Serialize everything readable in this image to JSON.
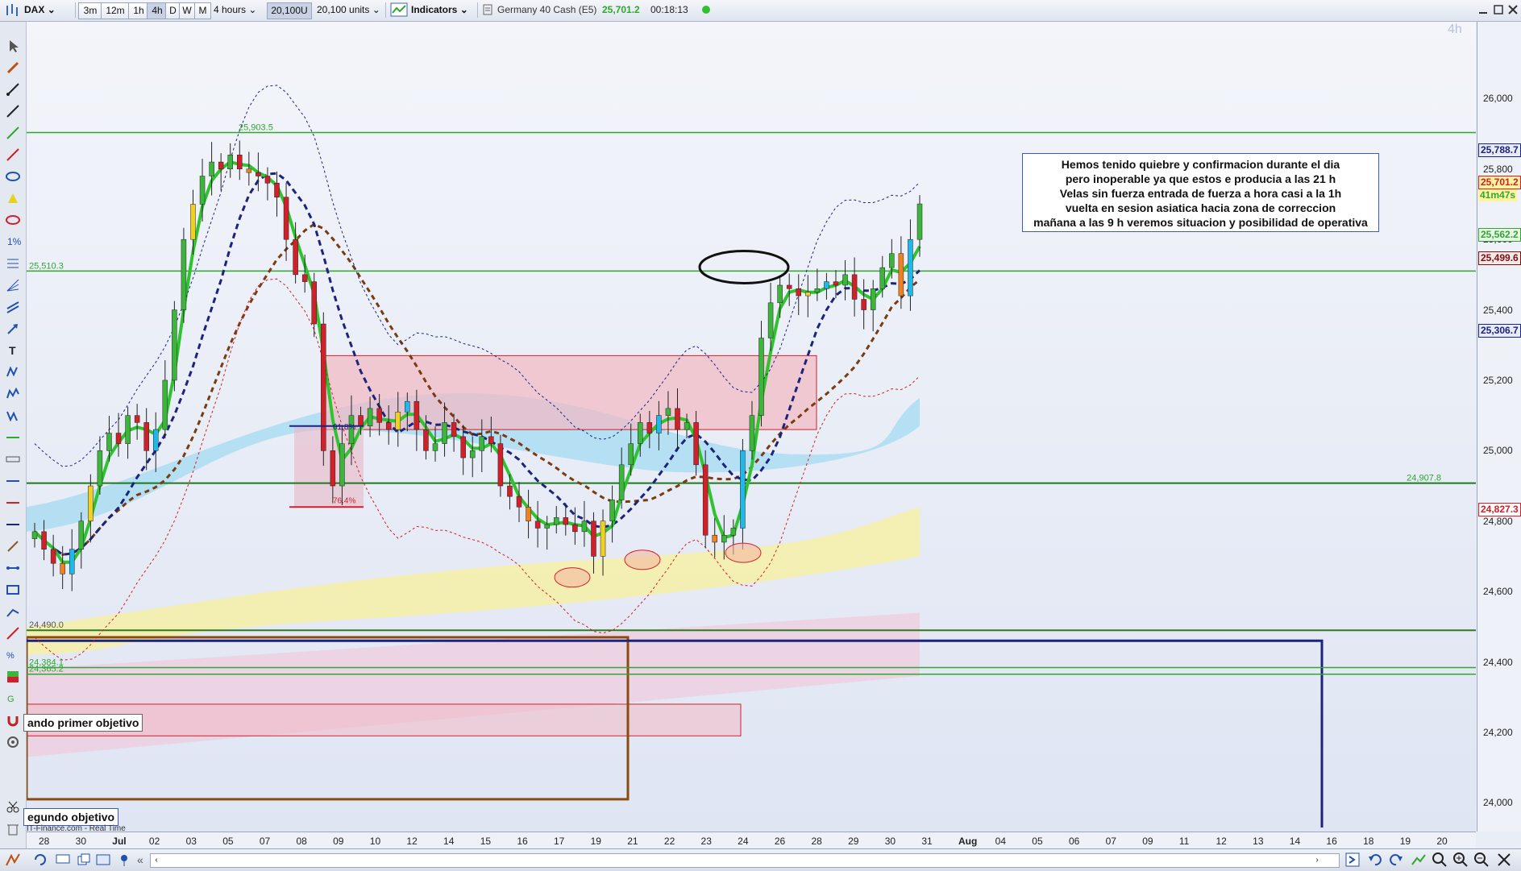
{
  "toolbar": {
    "instrument": "DAX",
    "timeframes": [
      "3m",
      "12m",
      "1h",
      "4h",
      "D",
      "W",
      "M"
    ],
    "active_timeframe": "4h",
    "period": "4 hours",
    "units_button": "20,100U",
    "units": "20,100 units",
    "indicators": "Indicators",
    "market_name": "Germany 40 Cash (E5)",
    "price": "25,701.2",
    "countdown": "00:18:13"
  },
  "chart_watermark": "4h",
  "note_lines": [
    "Hemos tenido quiebre y confirmacion durante el dia",
    "pero inoperable ya que estos e producia a las 21 h",
    "Velas sin fuerza entrada de fuerza a hora casi a la 1h",
    "vuelta en sesion asiatica hacia zona de correccion",
    "mañana a las 9 h veremos situacion y posibilidad de operativa"
  ],
  "objective_labels": {
    "first": "ando primer objetivo",
    "second": "egundo objetivo"
  },
  "source_label": "IT-Finance.com - Real Time",
  "colors": {
    "up_candle": "#3db53d",
    "down_candle": "#d0202a",
    "green_line": "#2fa82f",
    "navy": "#1c237e",
    "brown": "#7a3b10"
  },
  "chart_data": {
    "type": "candlestick",
    "title": "Germany 40 Cash (E5)",
    "timeframe": "4 hours",
    "ylim": [
      23900,
      26200
    ],
    "yticks": [
      "26,000",
      "25,800",
      "25,600",
      "25,400",
      "25,200",
      "25,000",
      "24,800",
      "24,600",
      "24,400",
      "24,200",
      "24,000"
    ],
    "xticks": [
      "28",
      "30",
      "Jul",
      "02",
      "03",
      "05",
      "07",
      "08",
      "09",
      "10",
      "12",
      "14",
      "15",
      "16",
      "17",
      "19",
      "21",
      "22",
      "23",
      "24",
      "26",
      "28",
      "29",
      "30",
      "31",
      "Aug",
      "04",
      "05",
      "06",
      "07",
      "09",
      "11",
      "12",
      "13",
      "14",
      "16",
      "18",
      "19",
      "20"
    ],
    "horizontal_levels": [
      {
        "label": "25,903.5",
        "value": 25903.5
      },
      {
        "label": "25,510.3",
        "value": 25510.3
      },
      {
        "label": "24,907.8",
        "value": 24907.8
      },
      {
        "label": "24,490.0",
        "value": 24490.0
      },
      {
        "label": "24,384.1",
        "value": 24384.1
      },
      {
        "label": "24,365.2",
        "value": 24365.2
      }
    ],
    "price_labels": [
      {
        "label": "25,788.7",
        "value": 25788.7,
        "color": "#1c237e"
      },
      {
        "label": "25,701.2",
        "value": 25701.2,
        "color": "#d0202a"
      },
      {
        "label": "41m47s",
        "value": 25662,
        "color": "#2fa82f"
      },
      {
        "label": "25,562.2",
        "value": 25562.2,
        "color": "#2fa82f"
      },
      {
        "label": "25,499.6",
        "value": 25499.6,
        "color": "#7a1010"
      },
      {
        "label": "25,306.7",
        "value": 25306.7,
        "color": "#1c237e"
      },
      {
        "label": "24,827.3",
        "value": 24827.3,
        "color": "#d0202a"
      }
    ],
    "fib_labels": [
      "61.8%",
      "76.4%"
    ],
    "close_prices": [
      24770,
      24720,
      24680,
      24650,
      24720,
      24800,
      24900,
      25000,
      25050,
      25020,
      25100,
      25080,
      25000,
      25060,
      25200,
      25400,
      25600,
      25700,
      25780,
      25820,
      25800,
      25840,
      25800,
      25790,
      25780,
      25760,
      25720,
      25600,
      25500,
      25480,
      25360,
      25000,
      24900,
      25020,
      25100,
      25070,
      25120,
      25080,
      25060,
      25110,
      25140,
      25060,
      25000,
      25020,
      25080,
      25040,
      24980,
      25000,
      25040,
      25020,
      24900,
      24870,
      24840,
      24800,
      24780,
      24790,
      24810,
      24790,
      24770,
      24800,
      24700,
      24800,
      24860,
      24960,
      25020,
      25080,
      25050,
      25100,
      25120,
      25060,
      25080,
      24960,
      24760,
      24740,
      24760,
      24780,
      25000,
      25100,
      25320,
      25420,
      25470,
      25460,
      25440,
      25450,
      25460,
      25480,
      25470,
      25500,
      25430,
      25400,
      25460,
      25520,
      25560,
      25440,
      25600,
      25701
    ]
  }
}
